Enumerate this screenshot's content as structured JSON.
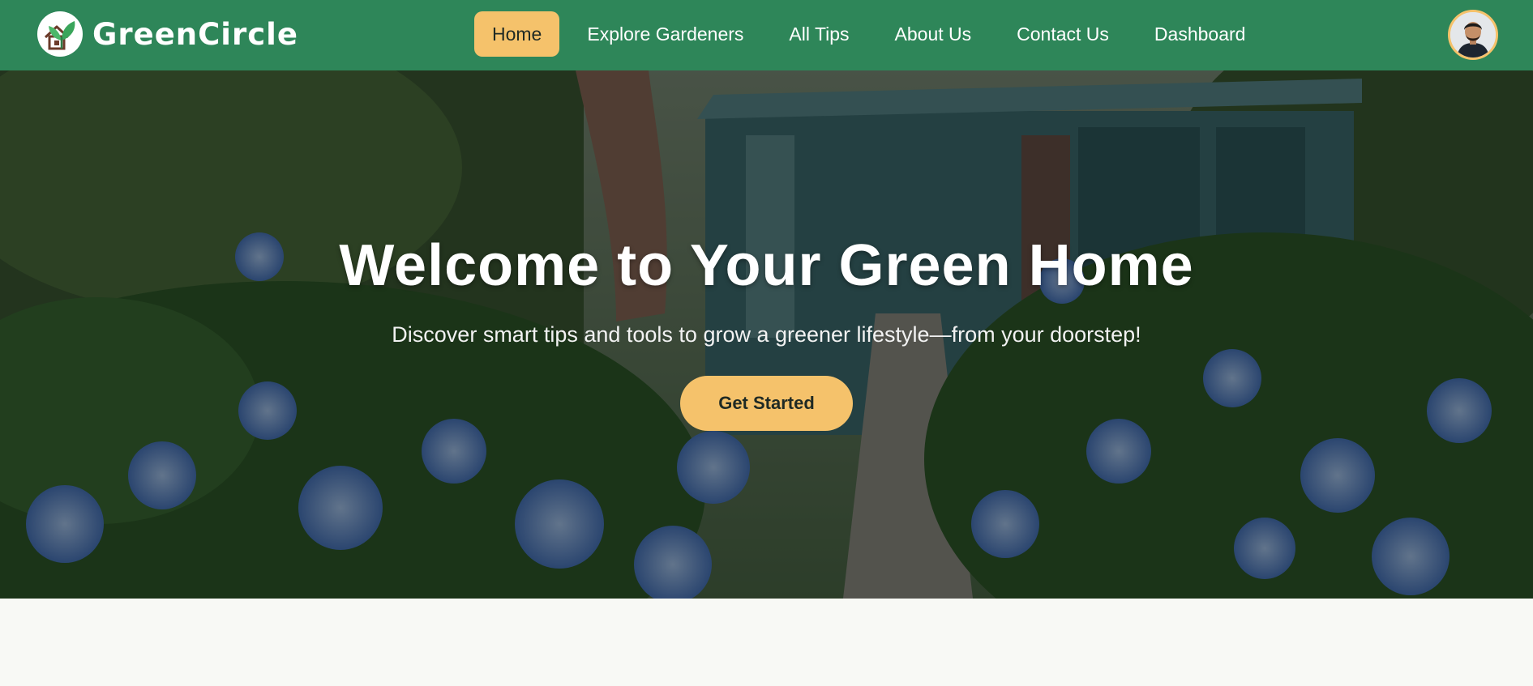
{
  "brand": {
    "name": "GreenCircle",
    "logo_icon": "house-leaf-logo-icon"
  },
  "nav": {
    "items": [
      {
        "label": "Home",
        "active": true
      },
      {
        "label": "Explore Gardeners",
        "active": false
      },
      {
        "label": "All Tips",
        "active": false
      },
      {
        "label": "About Us",
        "active": false
      },
      {
        "label": "Contact Us",
        "active": false
      },
      {
        "label": "Dashboard",
        "active": false
      }
    ]
  },
  "user": {
    "avatar_icon": "user-avatar"
  },
  "hero": {
    "title": "Welcome to Your Green Home",
    "subtitle": "Discover smart tips and tools to grow a greener lifestyle—from your doorstep!",
    "cta_label": "Get Started"
  },
  "colors": {
    "primary": "#2e8659",
    "accent": "#f5c26b",
    "background": "#f8f9f5",
    "text_light": "#ffffff"
  }
}
